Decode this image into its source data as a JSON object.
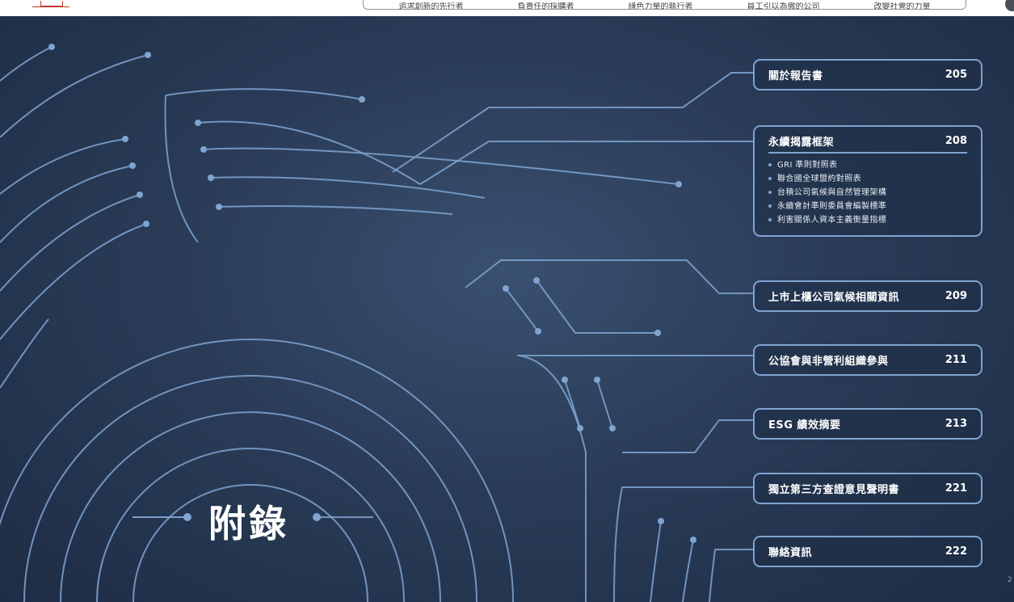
{
  "nav": {
    "items": [
      "追求創新的先行者",
      "負責任的採購者",
      "綠色力量的執行者",
      "員工引以為傲的公司",
      "改變社會的力量"
    ]
  },
  "section_title": "附錄",
  "toc": [
    {
      "title": "關於報告書",
      "page": "205"
    },
    {
      "title": "永續揭露框架",
      "page": "208",
      "subitems": [
        "GRI 準則對照表",
        "聯合國全球盟約對照表",
        "台積公司氣候與自然管理架構",
        "永續會計準則委員會編製標準",
        "利害關係人資本主義衡量指標"
      ]
    },
    {
      "title": "上市上櫃公司氣候相關資訊",
      "page": "209"
    },
    {
      "title": "公協會與非營利組織參與",
      "page": "211"
    },
    {
      "title": "ESG 績效摘要",
      "page": "213"
    },
    {
      "title": "獨立第三方查證意見聲明書",
      "page": "221"
    },
    {
      "title": "聯絡資訊",
      "page": "222"
    }
  ],
  "page_number": "2",
  "colors": {
    "accent": "#7fa4d1",
    "background": "#2a3c58"
  }
}
